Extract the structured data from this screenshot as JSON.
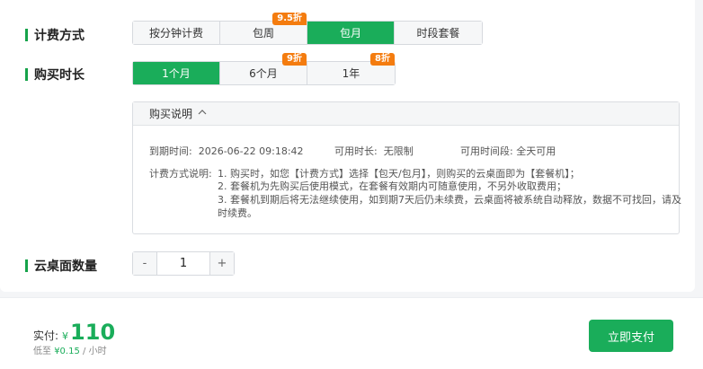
{
  "billing": {
    "label": "计费方式",
    "options": [
      {
        "label": "按分钟计费",
        "badge": ""
      },
      {
        "label": "包周",
        "badge": "9.5折"
      },
      {
        "label": "包月",
        "badge": ""
      },
      {
        "label": "时段套餐",
        "badge": ""
      }
    ],
    "selected": "包月"
  },
  "duration": {
    "label": "购买时长",
    "options": [
      {
        "label": "1个月",
        "badge": ""
      },
      {
        "label": "6个月",
        "badge": "9折"
      },
      {
        "label": "1年",
        "badge": "8折"
      }
    ],
    "selected": "1个月"
  },
  "info": {
    "title": "购买说明",
    "expire_key": "到期时间:",
    "expire_val": "2026-06-22 09:18:42",
    "usable_key": "可用时长:",
    "usable_val": "无限制",
    "period_key": "可用时间段:",
    "period_val": "全天可用",
    "method_key": "计费方式说明:",
    "lines": [
      "1. 购买时，如您【计费方式】选择【包天/包月】，则购买的云桌面即为【套餐机】；",
      "2. 套餐机为先购买后使用模式，在套餐有效期内可随意使用，不另外收取费用；",
      "3. 套餐机到期后将无法继续使用，如到期7天后仍未续费，云桌面将被系统自动释放，数据不可找回，请及",
      "时续费。"
    ]
  },
  "quantity": {
    "label": "云桌面数量",
    "minus": "-",
    "value": "1",
    "plus": "+"
  },
  "footer": {
    "pay_label": "实付:",
    "currency": "¥",
    "amount": "110",
    "hourly_prefix": "低至",
    "hourly_price": "¥0.15",
    "hourly_suffix": "/ 小时",
    "pay_button": "立即支付"
  },
  "colors": {
    "accent": "#1aad5a",
    "badge": "#f47c0f"
  }
}
